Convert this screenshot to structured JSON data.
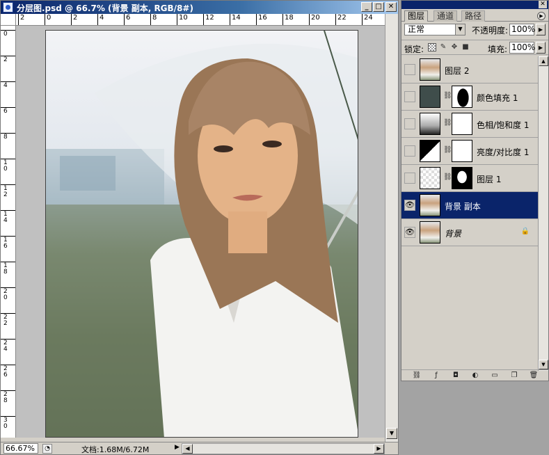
{
  "document": {
    "title": "分层图.psd @ 66.7% (背景 副本, RGB/8#)",
    "zoom": "66.67%",
    "doc_size": "文档:1.68M/6.72M",
    "ruler_h_labels": [
      "2",
      "0",
      "2",
      "4",
      "6",
      "8",
      "10",
      "12",
      "14",
      "16",
      "18",
      "20",
      "22",
      "24"
    ],
    "ruler_v_labels": [
      "0",
      "2",
      "4",
      "6",
      "8",
      "1\n0",
      "1\n2",
      "1\n4",
      "1\n6",
      "1\n8",
      "2\n0",
      "2\n2",
      "2\n4",
      "2\n6",
      "2\n8",
      "3\n0"
    ],
    "window_buttons": {
      "minimize": "_",
      "maximize": "□",
      "close": "✕"
    }
  },
  "layers_panel": {
    "tabs": [
      "图层",
      "通道",
      "路径"
    ],
    "active_tab": 0,
    "blend_mode": "正常",
    "opacity_label": "不透明度:",
    "opacity_value": "100%",
    "lock_label": "锁定:",
    "fill_label": "填充:",
    "fill_value": "100%",
    "selected_color": "#0a246a",
    "layers": [
      {
        "name": "图层 2",
        "visible": false,
        "thumb": "photo",
        "mask": "",
        "locked": false,
        "selected": false
      },
      {
        "name": "颜色填充 1",
        "visible": false,
        "thumb": "solid",
        "mask": "silhouette",
        "locked": false,
        "selected": false
      },
      {
        "name": "色相/饱和度 1",
        "visible": false,
        "thumb": "adjust",
        "mask": "white",
        "locked": false,
        "selected": false
      },
      {
        "name": "亮度/对比度 1",
        "visible": false,
        "thumb": "contrast",
        "mask": "white",
        "locked": false,
        "selected": false
      },
      {
        "name": "图层 1",
        "visible": false,
        "thumb": "transparent",
        "mask": "blackwhite",
        "locked": false,
        "selected": false
      },
      {
        "name": "背景 副本",
        "visible": true,
        "thumb": "photo",
        "mask": "",
        "locked": false,
        "selected": true
      },
      {
        "name": "背景",
        "visible": true,
        "thumb": "photo",
        "mask": "",
        "locked": true,
        "selected": false
      }
    ],
    "footer_icons": [
      "link-icon",
      "layer-style-icon",
      "mask-icon",
      "adjustment-icon",
      "group-icon",
      "new-layer-icon",
      "trash-icon"
    ]
  }
}
